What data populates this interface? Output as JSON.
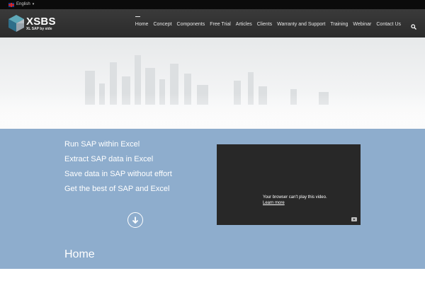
{
  "language": {
    "label": "English"
  },
  "logo": {
    "name": "XSBS",
    "tagline": "XL SAP by side"
  },
  "nav": {
    "items": [
      "Home",
      "Concept",
      "Components",
      "Free Trial",
      "Articles",
      "Clients",
      "Warranty and Support",
      "Training",
      "Webinar",
      "Contact Us"
    ],
    "active": "Home"
  },
  "hero": {
    "taglines": [
      "Run SAP within Excel",
      "Extract SAP data in Excel",
      "Save data in SAP without effort",
      "Get the best of SAP and Excel"
    ]
  },
  "video": {
    "message": "Your browser can't play this video.",
    "link": "Learn more"
  },
  "page": {
    "title": "Home"
  },
  "icons": {
    "search": "search-icon",
    "scroll_down": "arrow-down-circle-icon",
    "video_platform": "youtube-icon",
    "flag": "uk-flag-icon"
  },
  "colors": {
    "top_bar": "#0b0b0b",
    "header": "#333333",
    "blue_section": "#8eadcd",
    "video_bg": "#282828"
  }
}
